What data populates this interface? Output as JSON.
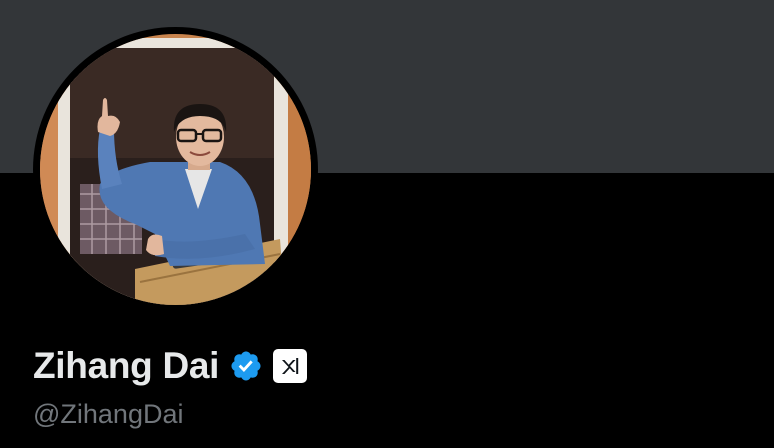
{
  "profile": {
    "display_name": "Zihang Dai",
    "handle": "@ZihangDai",
    "verified": true,
    "verified_icon": "verified-badge-icon",
    "affiliation_icon": "xai-logo-icon"
  },
  "colors": {
    "banner": "#333639",
    "background": "#000000",
    "name_text": "#e7e9ea",
    "handle_text": "#71767b",
    "verified_blue": "#1d9bf0"
  }
}
